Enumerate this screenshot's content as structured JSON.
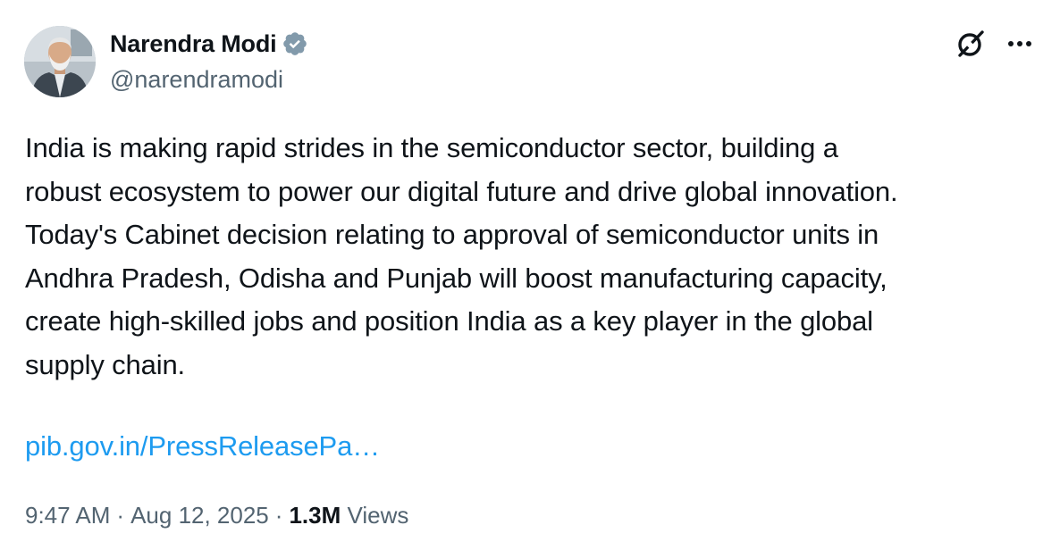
{
  "author": {
    "display_name": "Narendra Modi",
    "handle": "@narendramodi",
    "avatar_icon": "profile-photo",
    "verified_icon": "verified-badge-icon",
    "verified_color": "#829aab"
  },
  "header_actions": {
    "grok_icon": "grok-icon",
    "more_icon": "more-options-icon"
  },
  "tweet": {
    "text": "India is making rapid strides in the semiconductor sector, building a\nrobust ecosystem to power our digital future and drive global innovation.\nToday's Cabinet decision relating to approval of semiconductor units in\nAndhra Pradesh, Odisha and Punjab will boost manufacturing capacity,\ncreate high-skilled jobs and position India as a key player in the global\nsupply chain.",
    "link_text": "pib.gov.in/PressReleasePa…",
    "link_color": "#1d9bf0"
  },
  "meta": {
    "time": "9:47 AM",
    "separator": "·",
    "date": "Aug 12, 2025",
    "views_count": "1.3M",
    "views_label": "Views"
  },
  "colors": {
    "text_primary": "#0f1419",
    "text_secondary": "#536471",
    "background": "#ffffff"
  }
}
